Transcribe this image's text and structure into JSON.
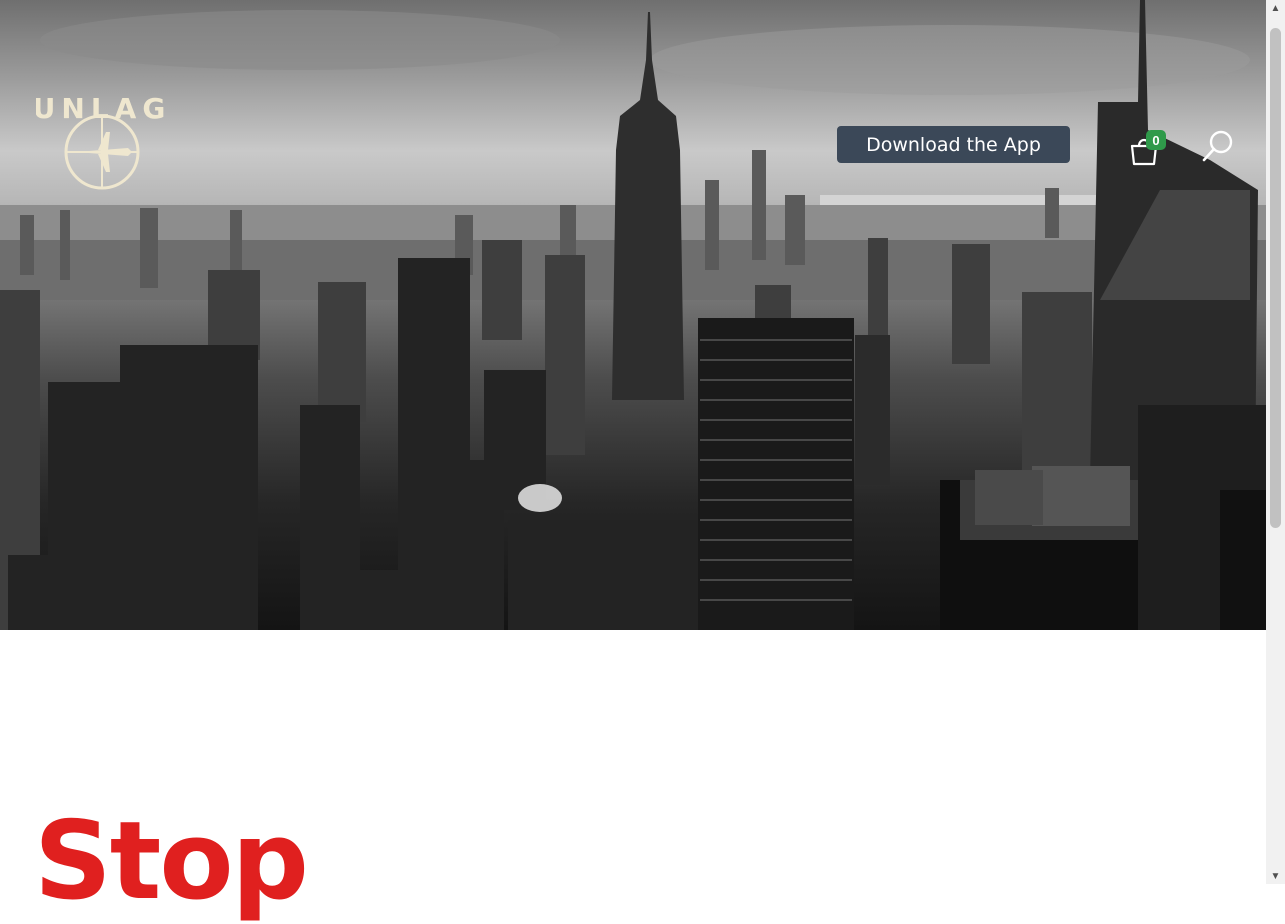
{
  "header": {
    "logo_text": "UNLAG",
    "download_label": "Download the App",
    "cart_count": "0"
  },
  "hero": {
    "image": "black-and-white New York City skyline"
  },
  "main": {
    "headline": "Stop"
  },
  "colors": {
    "button_bg": "#3b4858",
    "badge_bg": "#2f9a4a",
    "headline": "#e0201f",
    "logo": "#efe7cf"
  },
  "icons": {
    "cart": "shopping-bag-icon",
    "search": "search-icon",
    "logo_mark": "compass-plane-icon"
  }
}
